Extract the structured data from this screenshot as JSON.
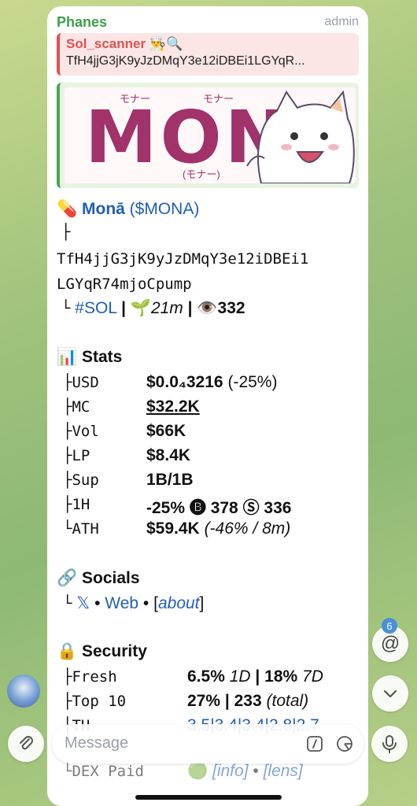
{
  "message": {
    "sender": "Phanes",
    "role": "admin",
    "reply": {
      "title": "Sol_scanner 👨‍🍳🔍",
      "address": "TfH4jjG3jK9yJzDMqY3e12iDBEi1LGYqR..."
    },
    "banner": {
      "big_text": "MONA",
      "katakana_1": "モナー",
      "katakana_2": "モナー",
      "katakana_3": "(モナー)"
    },
    "token": {
      "pill": "💊",
      "name": "Monā",
      "ticker": "($MONA)",
      "tree_char": "├",
      "address_line1": "TfH4jjG3jK9yJzDMqY3e12iDBEi1",
      "address_line2": "LGYqR74mjoCpump",
      "chain_prefix": "└",
      "chain": "#SOL",
      "sep": "|",
      "age_icon": "🌱",
      "age": "21m",
      "views_icon": "👁️",
      "views": "332"
    },
    "stats": {
      "icon": "📊",
      "title": "Stats",
      "rows": [
        {
          "prefix": "├",
          "label": "USD",
          "value": "$0.0₄3216",
          "extra": "(-25%)"
        },
        {
          "prefix": "├",
          "label": "MC",
          "value": "$32.2K",
          "extra": ""
        },
        {
          "prefix": "├",
          "label": "Vol",
          "value": "$66K",
          "extra": ""
        },
        {
          "prefix": "├",
          "label": "LP",
          "value": "$8.4K",
          "extra": ""
        },
        {
          "prefix": "├",
          "label": "Sup",
          "value": "1B/1B",
          "extra": ""
        },
        {
          "prefix": "├",
          "label": "1H",
          "value": "-25% 🅑 378 Ⓢ 336",
          "extra": ""
        },
        {
          "prefix": "└",
          "label": "ATH",
          "value": "$59.4K",
          "extra": "(-46% / 8m)"
        }
      ]
    },
    "socials": {
      "icon": "🔗",
      "title": "Socials",
      "prefix": "└",
      "x": "𝕏",
      "dot": "•",
      "web": "Web",
      "about_open": "[",
      "about": "about",
      "about_close": "]"
    },
    "security": {
      "icon": "🔒",
      "title": "Security",
      "rows": [
        {
          "prefix": "├",
          "label": "Fresh",
          "v1": "6.5%",
          "v1i": "1D",
          "sep": "|",
          "v2": "18%",
          "v2i": "7D"
        },
        {
          "prefix": "├",
          "label": "Top 10",
          "v1": "27%",
          "v1i": "",
          "sep": "|",
          "v2": "233",
          "v2i": "(total)"
        },
        {
          "prefix": "├",
          "label": "TH",
          "v1": "3.5|3.4|3.4|2.8|2.7",
          "v1i": "",
          "sep": "",
          "v2": "",
          "v2i": ""
        },
        {
          "prefix": "└",
          "label": "DEX Paid",
          "v1": "🟢",
          "v1i": "[info]",
          "sep": "•",
          "v2": "[lens]",
          "v2i": ""
        }
      ]
    }
  },
  "side_buttons": {
    "mention_badge": "6",
    "mention": "@"
  },
  "composer": {
    "placeholder": "Message"
  },
  "colors": {
    "sender_green": "#3aa14a",
    "link_blue": "#1f5fb4",
    "reply_red": "#d9534f",
    "mona_pink": "#a1326a"
  }
}
